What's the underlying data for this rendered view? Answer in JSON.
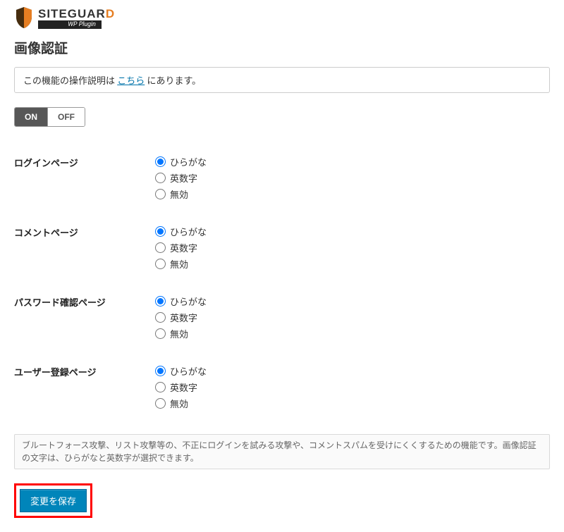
{
  "logo": {
    "text_main": "SITEGUAR",
    "text_accent": "D",
    "subtitle": "WP Plugin"
  },
  "page_title": "画像認証",
  "notice": {
    "prefix": "この機能の操作説明は ",
    "link": "こちら",
    "suffix": " にあります。"
  },
  "toggle": {
    "on": "ON",
    "off": "OFF",
    "active": "on"
  },
  "radio_options": {
    "hiragana": "ひらがな",
    "alphanumeric": "英数字",
    "disabled": "無効"
  },
  "sections": [
    {
      "label": "ログインページ",
      "selected": "hiragana"
    },
    {
      "label": "コメントページ",
      "selected": "hiragana"
    },
    {
      "label": "パスワード確認ページ",
      "selected": "hiragana"
    },
    {
      "label": "ユーザー登録ページ",
      "selected": "hiragana"
    }
  ],
  "description": "ブルートフォース攻撃、リスト攻撃等の、不正にログインを試みる攻撃や、コメントスパムを受けにくくするための機能です。画像認証の文字は、ひらがなと英数字が選択できます。",
  "save_button": "変更を保存"
}
